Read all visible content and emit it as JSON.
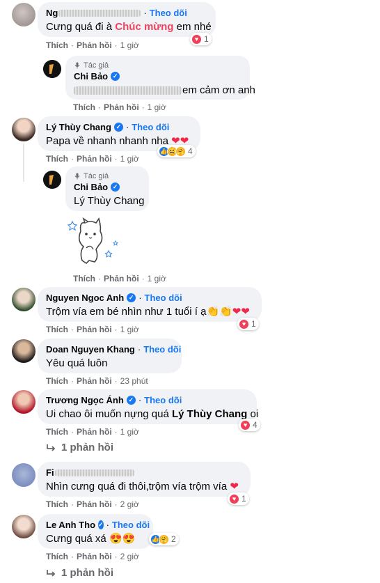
{
  "theme": {
    "follow": "#1877f2",
    "highlight": "#f3425f",
    "verified": "#1877f2"
  },
  "labels": {
    "like": "Thích",
    "reply": "Phản hồi",
    "follow": "Theo dõi",
    "author": "Tác giả",
    "dot": "·"
  },
  "comments": [
    {
      "name": "Ng",
      "text_before": "Cưng quá đi à ",
      "text_highlight": "Chúc mừng",
      "text_after": " em nhé",
      "reactions": "1",
      "time": "1 giờ"
    },
    {
      "name": "Chi Bảo",
      "text": "em cảm ơn anh",
      "time": "1 giờ"
    },
    {
      "name": "Lý Thùy Chang",
      "text": "Papa về nhanh nhanh nha ",
      "emoji": "❤❤",
      "reactions": "4",
      "time": "1 giờ"
    },
    {
      "name": "Chi Bảo",
      "mention": "Lý Thùy Chang",
      "time": "1 giờ"
    },
    {
      "name": "Nguyen Ngoc Anh",
      "text": "Trộm vía em bé nhìn như 1 tuổi í ạ",
      "emoji": "👏👏❤❤",
      "reactions": "1",
      "time": "1 giờ"
    },
    {
      "name": "Doan Nguyen Khang",
      "text": "Yêu quá luôn",
      "time": "23 phút"
    },
    {
      "name": "Trương Ngọc Ánh",
      "text": "Ui chao ôi muốn nựng quá ",
      "mention": "Lý Thùy Chang",
      "text_after": " oi",
      "reactions": "4",
      "time": "1 giờ",
      "more_replies": "1 phản hồi"
    },
    {
      "name": "Fi",
      "text": "Nhìn cưng quá đi thôi,trộm vía trộm vía ",
      "emoji": "❤",
      "reactions": "1",
      "time": "2 giờ"
    },
    {
      "name": "Le Anh Tho",
      "text": "Cưng quá xá ",
      "emoji": "😍😍",
      "reactions": "2",
      "time": "2 giờ",
      "more_replies": "1 phản hồi"
    }
  ]
}
